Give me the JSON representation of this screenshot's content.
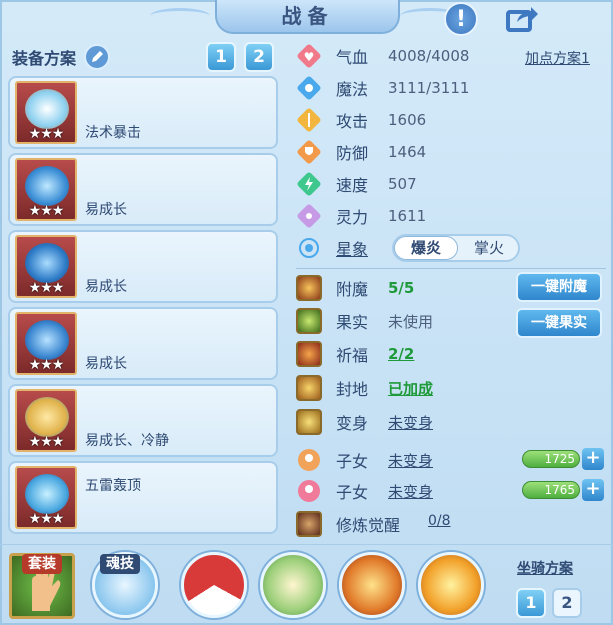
{
  "header": {
    "title": "战备"
  },
  "left": {
    "scheme_label": "装备方案",
    "scheme_buttons": [
      "1",
      "2"
    ],
    "equipment": [
      {
        "label": "法术暴击",
        "stars": "★★★",
        "art": "#8bd0f0"
      },
      {
        "label": "易成长",
        "stars": "★★★",
        "art": "#3c8fd6"
      },
      {
        "label": "易成长",
        "stars": "★★★",
        "art": "#2f7cc7"
      },
      {
        "label": "易成长",
        "stars": "★★★",
        "art": "#3a86d0"
      },
      {
        "label": "易成长、冷静",
        "stars": "★★★",
        "art": "#e0b24a"
      },
      {
        "label": "五雷轰顶",
        "stars": "★★★",
        "art": "#4aa8e0"
      }
    ]
  },
  "stats": {
    "plan_link": "加点方案1",
    "rows": [
      {
        "name": "气血",
        "value": "4008/4008",
        "color": "#f07a8a"
      },
      {
        "name": "魔法",
        "value": "3111/3111",
        "color": "#4aa8ec"
      },
      {
        "name": "攻击",
        "value": "1606",
        "color": "#f2b63e"
      },
      {
        "name": "防御",
        "value": "1464",
        "color": "#f29a4a"
      },
      {
        "name": "速度",
        "value": "507",
        "color": "#3fc88e"
      },
      {
        "name": "灵力",
        "value": "1611",
        "color": "#c79ae6"
      }
    ],
    "star_label": "星象",
    "star_on": "爆炎",
    "star_off": "掌火"
  },
  "extras": {
    "enchant": {
      "name": "附魔",
      "value": "5/5"
    },
    "fruit": {
      "name": "果实",
      "value": "未使用"
    },
    "bless": {
      "name": "祈福",
      "value": "2/2"
    },
    "seal": {
      "name": "封地",
      "value": "已加成"
    },
    "transform": {
      "name": "变身",
      "value": "未变身"
    },
    "child1": {
      "name": "子女",
      "value": "未变身",
      "bar": "1725"
    },
    "child2": {
      "name": "子女",
      "value": "未变身",
      "bar": "1765"
    },
    "awaken": {
      "name": "修炼觉醒",
      "value": "0/8"
    },
    "btn_enchant": "一键附魔",
    "btn_fruit": "一键果实"
  },
  "bottom": {
    "suit_tag": "套装",
    "soul_tag": "魂技",
    "mount_label": "坐骑方案",
    "mount_buttons": [
      "1",
      "2"
    ]
  }
}
